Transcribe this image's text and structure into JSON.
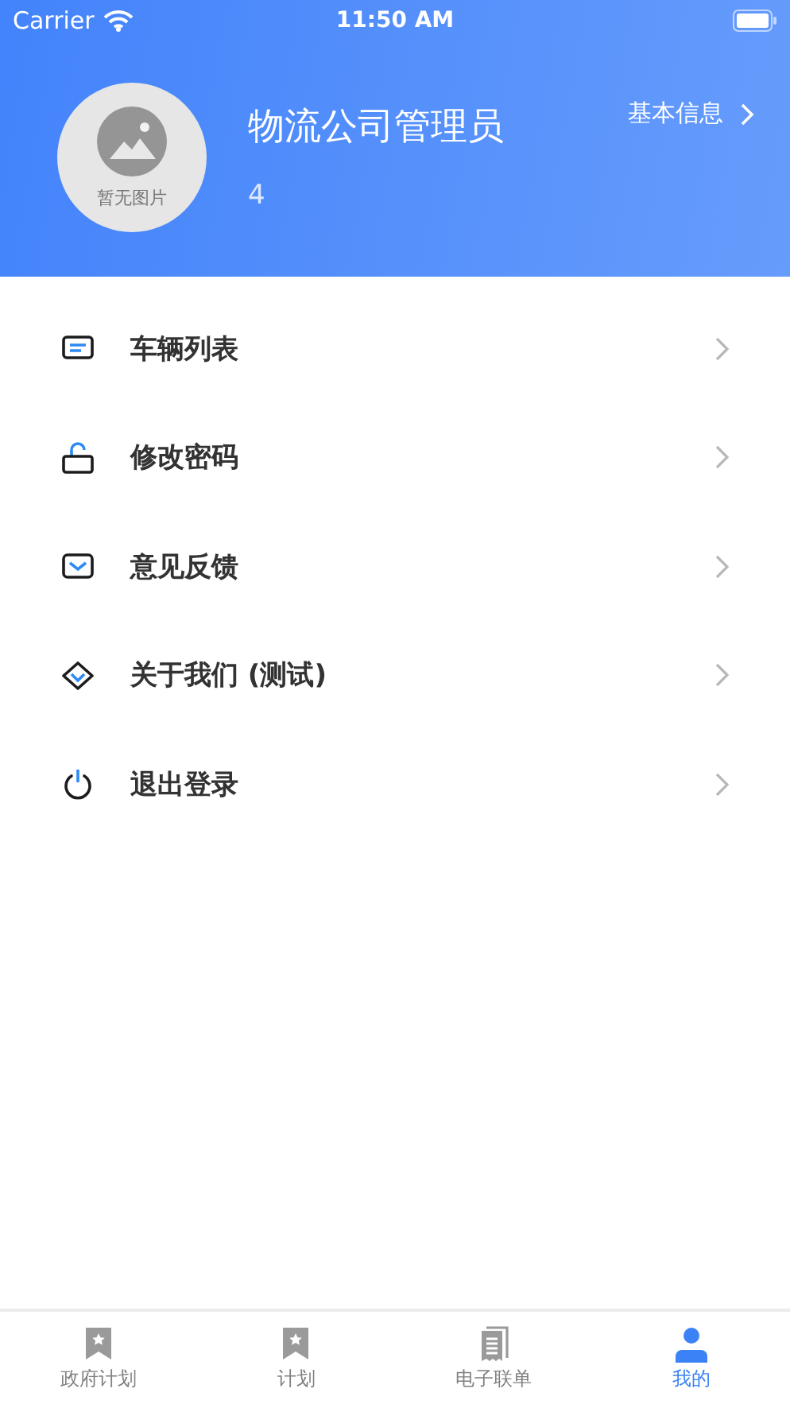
{
  "status_bar": {
    "carrier": "Carrier",
    "time": "11:50 AM"
  },
  "profile": {
    "avatar_text": "暂无图片",
    "name": "物流公司管理员",
    "id": "4",
    "info_link": "基本信息"
  },
  "menu": [
    {
      "kind": "list",
      "label": "车辆列表"
    },
    {
      "kind": "lock",
      "label": "修改密码"
    },
    {
      "kind": "mail",
      "label": "意见反馈"
    },
    {
      "kind": "diamond",
      "label": "关于我们 (测试)"
    },
    {
      "kind": "power",
      "label": "退出登录"
    }
  ],
  "tabs": [
    {
      "kind": "bookmark",
      "label": "政府计划",
      "selected": false
    },
    {
      "kind": "bookmark",
      "label": "计划",
      "selected": false
    },
    {
      "kind": "receipt",
      "label": "电子联单",
      "selected": false
    },
    {
      "kind": "person",
      "label": "我的",
      "selected": true
    }
  ]
}
